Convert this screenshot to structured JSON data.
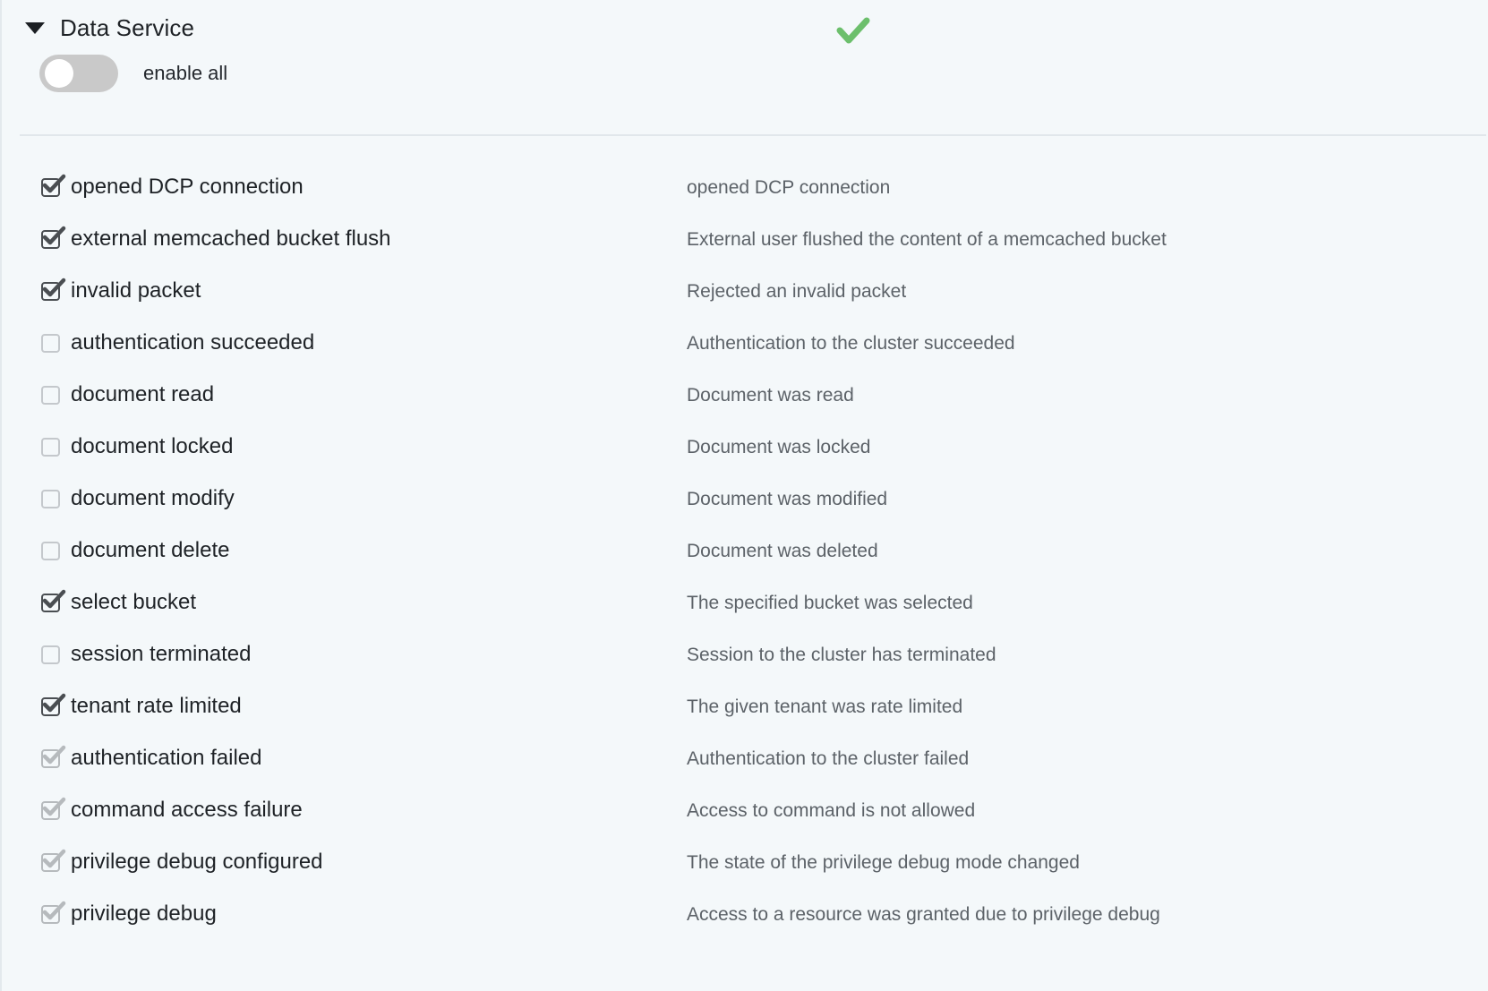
{
  "header": {
    "title": "Data Service",
    "caret_icon": "chevron-down-icon",
    "status_icon": "green-check-icon",
    "status_color": "#6cbf6c",
    "toggle": {
      "label": "enable all",
      "checked": false
    }
  },
  "rows": [
    {
      "label": "opened DCP connection",
      "desc": "opened DCP connection",
      "checked": true,
      "locked": false
    },
    {
      "label": "external memcached bucket flush",
      "desc": "External user flushed the content of a memcached bucket",
      "checked": true,
      "locked": false
    },
    {
      "label": "invalid packet",
      "desc": "Rejected an invalid packet",
      "checked": true,
      "locked": false
    },
    {
      "label": "authentication succeeded",
      "desc": "Authentication to the cluster succeeded",
      "checked": false,
      "locked": false
    },
    {
      "label": "document read",
      "desc": "Document was read",
      "checked": false,
      "locked": false
    },
    {
      "label": "document locked",
      "desc": "Document was locked",
      "checked": false,
      "locked": false
    },
    {
      "label": "document modify",
      "desc": "Document was modified",
      "checked": false,
      "locked": false
    },
    {
      "label": "document delete",
      "desc": "Document was deleted",
      "checked": false,
      "locked": false
    },
    {
      "label": "select bucket",
      "desc": "The specified bucket was selected",
      "checked": true,
      "locked": false
    },
    {
      "label": "session terminated",
      "desc": "Session to the cluster has terminated",
      "checked": false,
      "locked": false
    },
    {
      "label": "tenant rate limited",
      "desc": "The given tenant was rate limited",
      "checked": true,
      "locked": false
    },
    {
      "label": "authentication failed",
      "desc": "Authentication to the cluster failed",
      "checked": true,
      "locked": true
    },
    {
      "label": "command access failure",
      "desc": "Access to command is not allowed",
      "checked": true,
      "locked": true
    },
    {
      "label": "privilege debug configured",
      "desc": "The state of the privilege debug mode changed",
      "checked": true,
      "locked": true
    },
    {
      "label": "privilege debug",
      "desc": "Access to a resource was granted due to privilege debug",
      "checked": true,
      "locked": true
    }
  ],
  "colors": {
    "background": "#f4f8fa",
    "divider": "#e1e7eb",
    "label_text": "#1e2226",
    "desc_text": "#5c6268",
    "checkbox_enabled": "#4a4e52",
    "checkbox_locked": "#b6babd",
    "checkbox_empty": "#c4c8cc",
    "toggle_off": "#c9c9c9"
  }
}
